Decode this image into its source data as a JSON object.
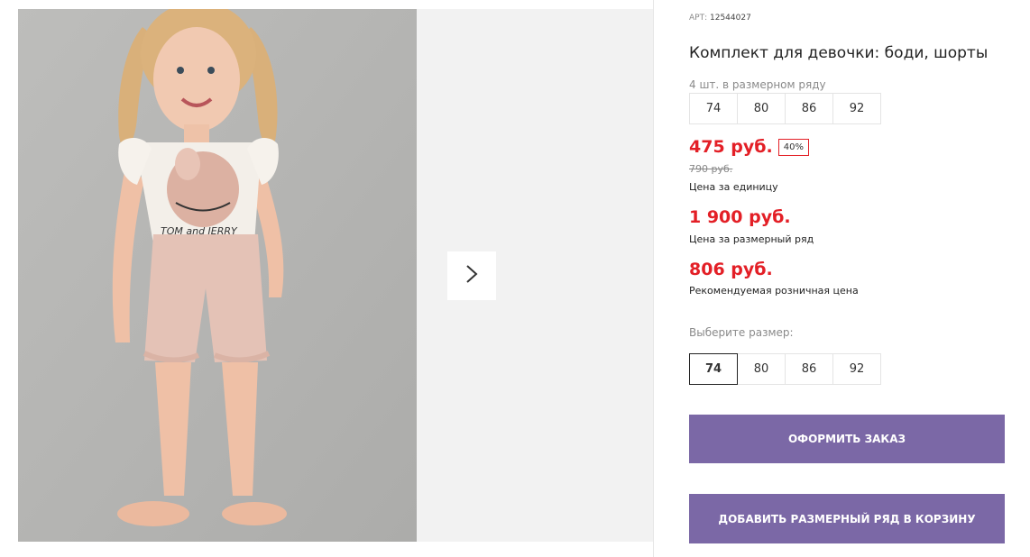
{
  "gallery": {
    "next_icon": "chevron-right-icon",
    "print_text": "TOM and JERRY"
  },
  "product": {
    "sku_label": "АРТ:",
    "sku_value": "12544027",
    "title": "Комплект для девочки: боди, шорты",
    "pack_note": "4 шт. в размерном ряду",
    "pack_sizes": [
      "74",
      "80",
      "86",
      "92"
    ],
    "unit_price": "475 руб.",
    "discount": "40%",
    "old_price": "790 руб.",
    "unit_price_caption": "Цена за единицу",
    "pack_price": "1 900 руб.",
    "pack_price_caption": "Цена за размерный ряд",
    "retail_price": "806 руб.",
    "retail_price_caption": "Рекомендуемая розничная цена",
    "choose_size_label": "Выберите размер:",
    "size_options": [
      "74",
      "80",
      "86",
      "92"
    ],
    "selected_size": "74"
  },
  "actions": {
    "checkout_label": "ОФОРМИТЬ ЗАКАЗ",
    "add_pack_label": "ДОБАВИТЬ РАЗМЕРНЫЙ РЯД В КОРЗИНУ"
  },
  "colors": {
    "price_red": "#e31f26",
    "button_purple": "#7b68a6",
    "photo_bg": "#b9b9b7"
  }
}
